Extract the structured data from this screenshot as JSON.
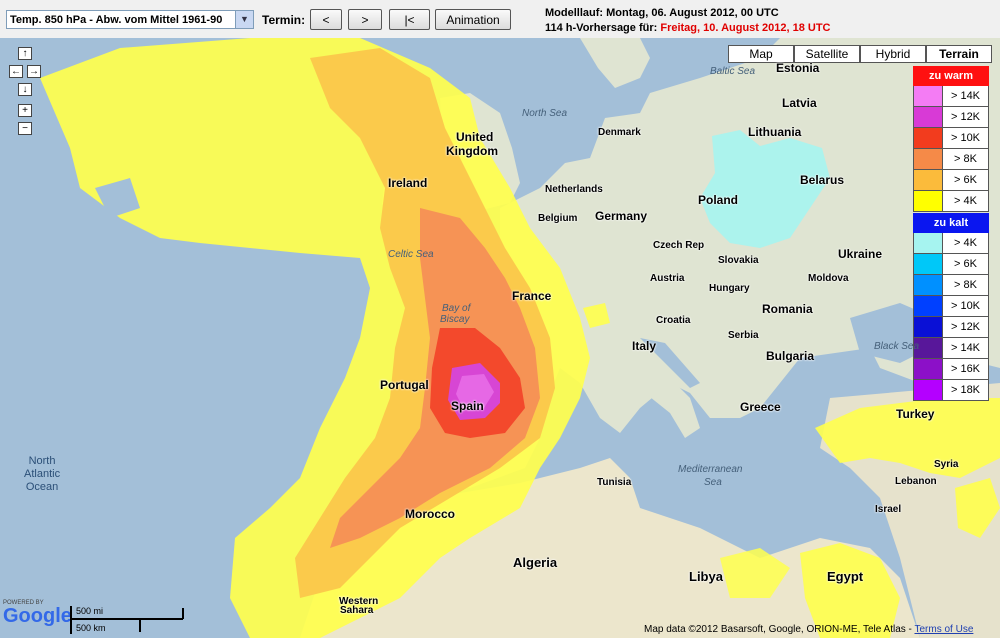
{
  "toolbar": {
    "parameter_select": "Temp. 850 hPa - Abw. vom Mittel 1961-90",
    "termin_label": "Termin:",
    "prev_label": "<",
    "next_label": ">",
    "first_label": "|<",
    "animation_label": "Animation",
    "modelllauf": "Modelllauf: Montag, 06. August 2012, 00 UTC",
    "forecast_prefix": "114 h-Vorhersage für:",
    "forecast_date": "Freitag, 10. August 2012, 18 UTC"
  },
  "map_types": [
    "Map",
    "Satellite",
    "Hybrid",
    "Terrain"
  ],
  "active_map_type": "Terrain",
  "nav": {
    "up": "↑",
    "left": "←",
    "right": "→",
    "down": "↓",
    "zoom_in": "+",
    "zoom_out": "−"
  },
  "legend": {
    "warm_title": "zu warm",
    "cold_title": "zu kalt",
    "warm": [
      {
        "label": "> 14K",
        "color": "#f47cf4"
      },
      {
        "label": "> 12K",
        "color": "#d83ad6"
      },
      {
        "label": "> 10K",
        "color": "#f23c1e"
      },
      {
        "label": "> 8K",
        "color": "#f58a48"
      },
      {
        "label": "> 6K",
        "color": "#fbbb3b"
      },
      {
        "label": "> 4K",
        "color": "#ffff00"
      }
    ],
    "cold": [
      {
        "label": "> 4K",
        "color": "#a6f4f0"
      },
      {
        "label": "> 6K",
        "color": "#00c8f8"
      },
      {
        "label": "> 8K",
        "color": "#0090ff"
      },
      {
        "label": "> 10K",
        "color": "#0040ff"
      },
      {
        "label": "> 12K",
        "color": "#0a10d6"
      },
      {
        "label": "> 14K",
        "color": "#58179a"
      },
      {
        "label": "> 16K",
        "color": "#8c10c8"
      },
      {
        "label": "> 18K",
        "color": "#b400ff"
      }
    ]
  },
  "labels": {
    "estonia": "Estonia",
    "baltic_sea": "Baltic Sea",
    "latvia": "Latvia",
    "north_sea": "North Sea",
    "denmark": "Denmark",
    "lithuania": "Lithuania",
    "united": "United",
    "kingdom": "Kingdom",
    "belarus": "Belarus",
    "ireland": "Ireland",
    "netherlands": "Netherlands",
    "poland": "Poland",
    "belgium": "Belgium",
    "germany": "Germany",
    "celtic_sea": "Celtic Sea",
    "czech": "Czech Rep",
    "ukraine": "Ukraine",
    "slovakia": "Slovakia",
    "austria": "Austria",
    "moldova": "Moldova",
    "hungary": "Hungary",
    "france": "France",
    "bay_of": "Bay of",
    "biscay": "Biscay",
    "romania": "Romania",
    "croatia": "Croatia",
    "serbia": "Serbia",
    "italy": "Italy",
    "black_sea": "Black Sea",
    "bulgaria": "Bulgaria",
    "portugal": "Portugal",
    "spain": "Spain",
    "greece": "Greece",
    "turkey": "Turkey",
    "north": "North",
    "atlantic": "Atlantic",
    "ocean": "Ocean",
    "tunisia": "Tunisia",
    "syria": "Syria",
    "mediterranean": "Mediterranean",
    "sea": "Sea",
    "lebanon": "Lebanon",
    "morocco": "Morocco",
    "israel": "Israel",
    "algeria": "Algeria",
    "libya": "Libya",
    "egypt": "Egypt",
    "western": "Western",
    "sahara": "Sahara"
  },
  "scale": {
    "mi": "500 mi",
    "km": "500 km"
  },
  "logo": {
    "powered": "POWERED BY",
    "google": "Google"
  },
  "attribution": {
    "text": "Map data ©2012 Basarsoft, Google, ORION-ME, Tele Atlas -",
    "terms": "Terms of Use"
  }
}
